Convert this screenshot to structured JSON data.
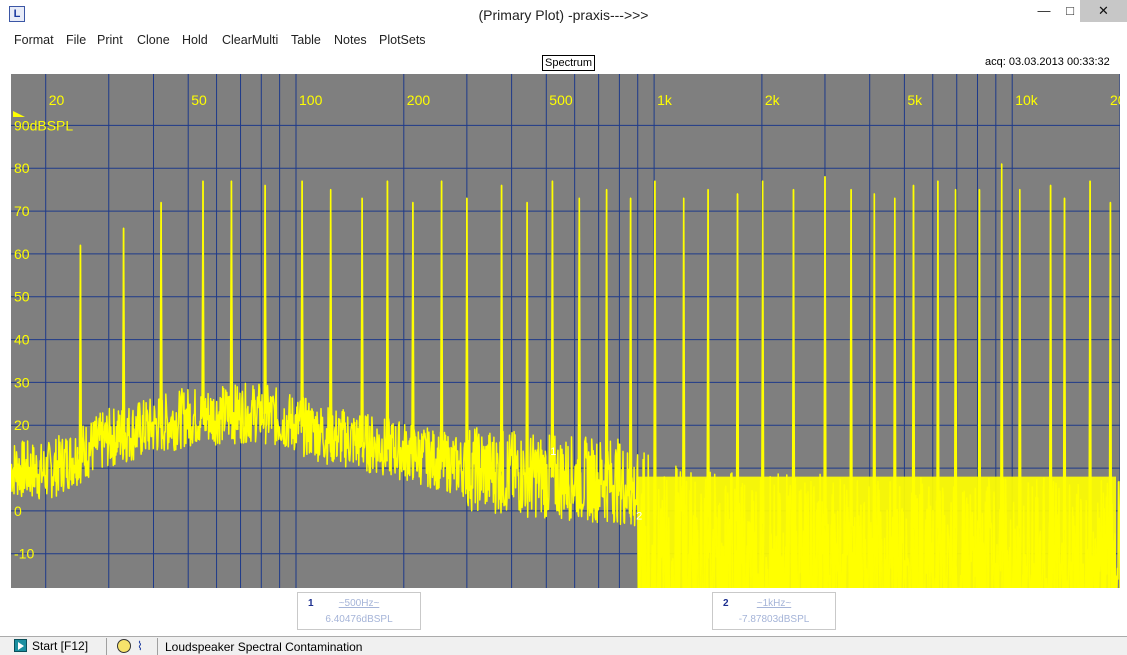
{
  "window": {
    "title": "(Primary Plot) -praxis--->>>",
    "minimize_glyph": "—",
    "maximize_glyph": "□",
    "close_glyph": "✕",
    "app_icon_text": "L"
  },
  "menu": [
    "Format",
    "File",
    "Print",
    "Clone",
    "Hold",
    "ClearMulti",
    "Table",
    "Notes",
    "PlotSets"
  ],
  "plot": {
    "title_box": "Spectrum",
    "acq": "acq: 03.03.2013 00:33:32",
    "background_color": "#7f7f7f",
    "grid_color": "#1e3a8a",
    "trace_color": "#ffff00",
    "y_unit_label": "90dBSPL"
  },
  "chart_data": {
    "type": "line",
    "x_scale": "log",
    "xlim": [
      16,
      20000
    ],
    "ylim": [
      -18,
      102
    ],
    "x_ticks": [
      {
        "value": 20,
        "label": "20"
      },
      {
        "value": 50,
        "label": "50"
      },
      {
        "value": 100,
        "label": "100"
      },
      {
        "value": 200,
        "label": "200"
      },
      {
        "value": 500,
        "label": "500"
      },
      {
        "value": 1000,
        "label": "1k"
      },
      {
        "value": 2000,
        "label": "2k"
      },
      {
        "value": 5000,
        "label": "5k"
      },
      {
        "value": 10000,
        "label": "10k"
      },
      {
        "value": 20000,
        "label": "20"
      }
    ],
    "y_ticks": [
      {
        "value": 80,
        "label": "80"
      },
      {
        "value": 70,
        "label": "70"
      },
      {
        "value": 60,
        "label": "60"
      },
      {
        "value": 50,
        "label": "50"
      },
      {
        "value": 40,
        "label": "40"
      },
      {
        "value": 30,
        "label": "30"
      },
      {
        "value": 20,
        "label": "20"
      },
      {
        "value": 10,
        "label": "10"
      },
      {
        "value": 0,
        "label": "0"
      },
      {
        "value": -10,
        "label": "-10"
      }
    ],
    "series": [
      {
        "harmonic_peaks": [
          {
            "f": 25,
            "db": 62
          },
          {
            "f": 33,
            "db": 66
          },
          {
            "f": 42,
            "db": 72
          },
          {
            "f": 55,
            "db": 77
          },
          {
            "f": 66,
            "db": 77
          },
          {
            "f": 82,
            "db": 76
          },
          {
            "f": 104,
            "db": 77
          },
          {
            "f": 125,
            "db": 75
          },
          {
            "f": 153,
            "db": 73
          },
          {
            "f": 180,
            "db": 77
          },
          {
            "f": 212,
            "db": 72
          },
          {
            "f": 255,
            "db": 77
          },
          {
            "f": 300,
            "db": 73
          },
          {
            "f": 375,
            "db": 76
          },
          {
            "f": 442,
            "db": 72
          },
          {
            "f": 520,
            "db": 77
          },
          {
            "f": 618,
            "db": 73
          },
          {
            "f": 737,
            "db": 75
          },
          {
            "f": 860,
            "db": 73
          },
          {
            "f": 1005,
            "db": 77
          },
          {
            "f": 1210,
            "db": 73
          },
          {
            "f": 1415,
            "db": 75
          },
          {
            "f": 1710,
            "db": 74
          },
          {
            "f": 2010,
            "db": 77
          },
          {
            "f": 2450,
            "db": 75
          },
          {
            "f": 3000,
            "db": 78
          },
          {
            "f": 3550,
            "db": 75
          },
          {
            "f": 4120,
            "db": 74
          },
          {
            "f": 4700,
            "db": 73
          },
          {
            "f": 5300,
            "db": 76
          },
          {
            "f": 6200,
            "db": 77
          },
          {
            "f": 6950,
            "db": 75
          },
          {
            "f": 8100,
            "db": 75
          },
          {
            "f": 9350,
            "db": 81
          },
          {
            "f": 10500,
            "db": 75
          },
          {
            "f": 12800,
            "db": 76
          },
          {
            "f": 14000,
            "db": 73
          },
          {
            "f": 16500,
            "db": 77
          },
          {
            "f": 18800,
            "db": 72
          }
        ],
        "noise_floor": [
          {
            "f": 16,
            "db": 10
          },
          {
            "f": 20,
            "db": 9
          },
          {
            "f": 30,
            "db": 17
          },
          {
            "f": 50,
            "db": 22
          },
          {
            "f": 80,
            "db": 23
          },
          {
            "f": 120,
            "db": 18
          },
          {
            "f": 200,
            "db": 14
          },
          {
            "f": 300,
            "db": 10
          },
          {
            "f": 500,
            "db": 8
          },
          {
            "f": 800,
            "db": 7
          },
          {
            "f": 1000,
            "db": 0
          },
          {
            "f": 2000,
            "db": -3
          },
          {
            "f": 5000,
            "db": -4
          },
          {
            "f": 10000,
            "db": -4
          },
          {
            "f": 20000,
            "db": -5
          }
        ]
      }
    ]
  },
  "markers": [
    {
      "num": "1",
      "freq": "~500Hz~",
      "level": "6.40476dBSPL"
    },
    {
      "num": "2",
      "freq": "~1kHz~",
      "level": "-7.87803dBSPL"
    }
  ],
  "plot_annotations": [
    {
      "text": "1"
    },
    {
      "text": "2"
    }
  ],
  "status": {
    "start_label": "Start [F12]",
    "text": "Loudspeaker Spectral Contamination"
  }
}
